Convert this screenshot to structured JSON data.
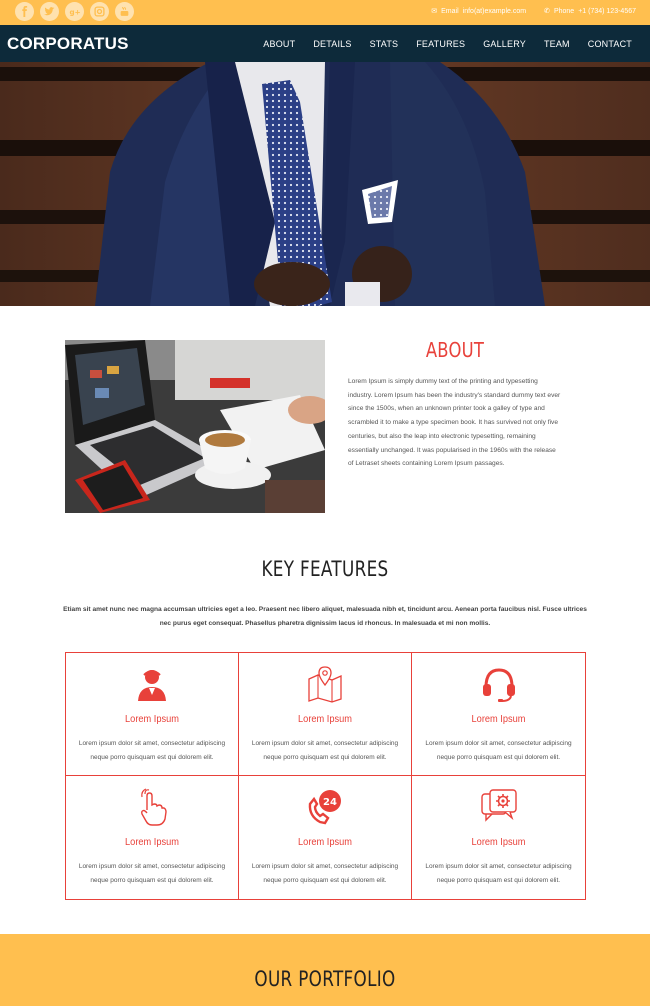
{
  "topbar": {
    "social": [
      "facebook-icon",
      "twitter-icon",
      "google-plus-icon",
      "instagram-icon",
      "youtube-icon"
    ],
    "email_label": "Email",
    "email_value": "info(at)example.com",
    "phone_label": "Phone",
    "phone_value": "+1 (734) 123-4567",
    "bg_color": "#ffbf4f"
  },
  "nav": {
    "logo": "CORPORATUS",
    "links": [
      "ABOUT",
      "DETAILS",
      "STATS",
      "FEATURES",
      "GALLERY",
      "TEAM",
      "CONTACT"
    ],
    "bg_color": "#0d2a3a"
  },
  "about": {
    "title": "ABOUT",
    "text": "Lorem Ipsum is simply dummy text of the printing and typesetting industry. Lorem Ipsum has been the industry's standard dummy text ever since the 1500s, when an unknown printer took a galley of type and scrambled it to make a type specimen book. It has survived not only five centuries, but also the leap into electronic typesetting, remaining essentially unchanged. It was popularised in the 1960s with the release of Letraset sheets containing Lorem Ipsum passages."
  },
  "features": {
    "title": "KEY FEATURES",
    "intro": "Etiam sit amet nunc nec magna accumsan ultricies eget a leo. Praesent nec libero aliquet, malesuada nibh et, tincidunt arcu. Aenean porta faucibus nisl. Fusce ultrices nec purus eget consequat. Phasellus pharetra dignissim lacus id rhoncus. In malesuada et mi non mollis.",
    "items": [
      {
        "icon": "user-support-icon",
        "title": "Lorem Ipsum",
        "text": "Lorem ipsum dolor sit amet, consectetur adipiscing neque porro quisquam est qui dolorem elit."
      },
      {
        "icon": "map-pin-icon",
        "title": "Lorem Ipsum",
        "text": "Lorem ipsum dolor sit amet, consectetur adipiscing neque porro quisquam est qui dolorem elit."
      },
      {
        "icon": "headset-icon",
        "title": "Lorem Ipsum",
        "text": "Lorem ipsum dolor sit amet, consectetur adipiscing neque porro quisquam est qui dolorem elit."
      },
      {
        "icon": "touch-hand-icon",
        "title": "Lorem Ipsum",
        "text": "Lorem ipsum dolor sit amet, consectetur adipiscing neque porro quisquam est qui dolorem elit."
      },
      {
        "icon": "phone-24-icon",
        "title": "Lorem Ipsum",
        "text": "Lorem ipsum dolor sit amet, consectetur adipiscing neque porro quisquam est qui dolorem elit."
      },
      {
        "icon": "settings-chat-icon",
        "title": "Lorem Ipsum",
        "text": "Lorem ipsum dolor sit amet, consectetur adipiscing neque porro quisquam est qui dolorem elit."
      }
    ],
    "accent_color": "#e8413a"
  },
  "portfolio": {
    "title": "OUR PORTFOLIO"
  }
}
